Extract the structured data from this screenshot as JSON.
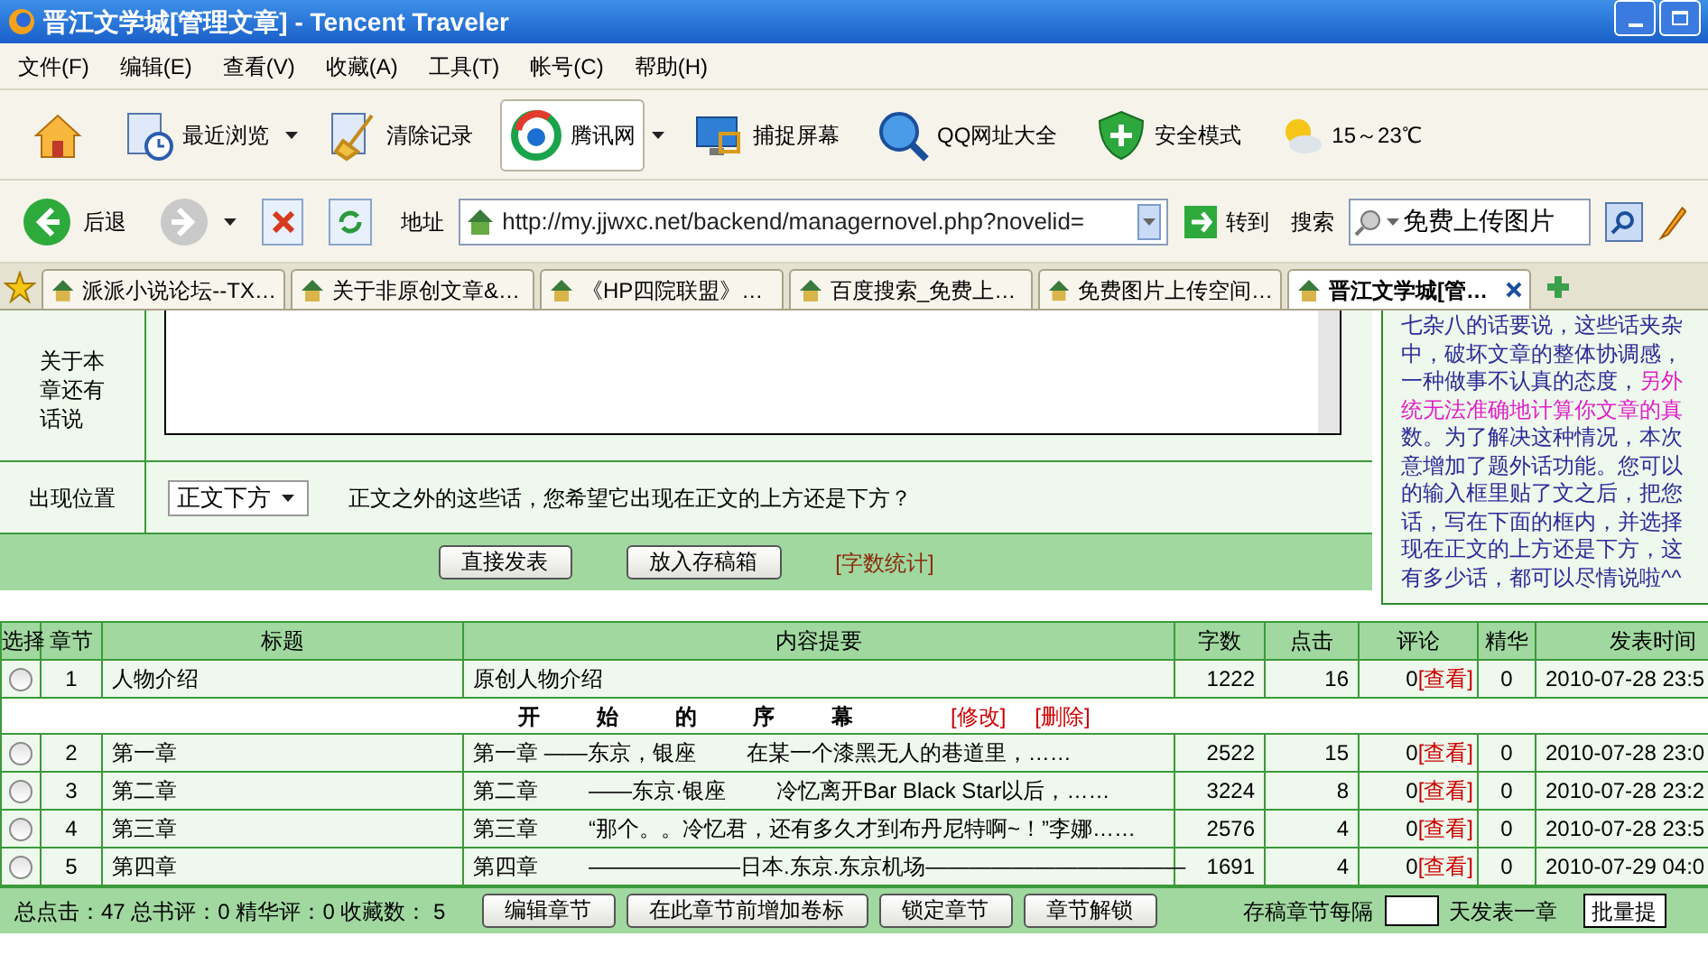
{
  "window": {
    "title": "晋江文学城[管理文章] - Tencent Traveler"
  },
  "menu": [
    "文件(F)",
    "编辑(E)",
    "查看(V)",
    "收藏(A)",
    "工具(T)",
    "帐号(C)",
    "帮助(H)"
  ],
  "toolbar": [
    {
      "kind": "home",
      "dropdown": false,
      "selected": false
    },
    {
      "kind": "history",
      "label": "最近浏览",
      "dropdown": true,
      "selected": false
    },
    {
      "kind": "clear",
      "label": "清除记录",
      "dropdown": false,
      "selected": false
    },
    {
      "kind": "portal",
      "label": "腾讯网",
      "dropdown": true,
      "selected": true
    },
    {
      "kind": "capture",
      "label": "捕捉屏幕",
      "dropdown": false,
      "selected": false
    },
    {
      "kind": "search",
      "label": "QQ网址大全",
      "dropdown": false,
      "selected": false
    },
    {
      "kind": "shield",
      "label": "安全模式",
      "dropdown": false,
      "selected": false
    },
    {
      "kind": "weather",
      "label": "15～23℃",
      "dropdown": false,
      "selected": false
    }
  ],
  "nav": {
    "back": "后退",
    "forward_disabled": true,
    "address_label": "地址",
    "url": "http://my.jjwxc.net/backend/managernovel.php?novelid=",
    "go": "转到",
    "search_label": "搜索",
    "search_value": "免费上传图片"
  },
  "tabs": [
    {
      "label": "派派小说论坛--TX…",
      "selected": false
    },
    {
      "label": "关于非原创文章&…",
      "selected": false
    },
    {
      "label": "《HP四院联盟》…",
      "selected": false
    },
    {
      "label": "百度搜索_免费上…",
      "selected": false
    },
    {
      "label": "免费图片上传空间…",
      "selected": false
    },
    {
      "label": "晋江文学城[管…",
      "selected": true
    }
  ],
  "form": {
    "note_label": "关于本章还有话说",
    "position_label": "出现位置",
    "position_value": "正文下方",
    "position_hint": "正文之外的这些话，您希望它出现在正文的上方还是下方？",
    "buttons": [
      "直接发表",
      "放入存稿箱"
    ],
    "word_count_link": "[字数统计]"
  },
  "notice": [
    [
      {
        "text": "七杂八的话要说，这些话夹杂",
        "highlight": false
      }
    ],
    [
      {
        "text": "中，破坏文章的整体协调感，",
        "highlight": false
      }
    ],
    [
      {
        "text": "一种做事不认真的态度，",
        "highlight": false
      },
      {
        "text": "另外",
        "highlight": true
      }
    ],
    [
      {
        "text": "统无法准确地计算你文章的真",
        "highlight": true
      }
    ],
    [
      {
        "text": "数。为了解决这种情况，本次",
        "highlight": false
      }
    ],
    [
      {
        "text": "意增加了题外话功能。您可以",
        "highlight": false
      }
    ],
    [
      {
        "text": "的输入框里贴了文之后，把您",
        "highlight": false
      }
    ],
    [
      {
        "text": "话，写在下面的框内，并选择",
        "highlight": false
      }
    ],
    [
      {
        "text": "现在正文的上方还是下方，这",
        "highlight": false
      }
    ],
    [
      {
        "text": "有多少话，都可以尽情说啦^^",
        "highlight": false
      }
    ]
  ],
  "table": {
    "columns": [
      "选择",
      "章节",
      "标题",
      "内容提要",
      "字数",
      "点击",
      "评论",
      "精华",
      "发表时间"
    ],
    "rows": [
      {
        "kind": "chapter",
        "selected": false,
        "number": "1",
        "title": "人物介绍",
        "summary": [
          "原创人物介绍"
        ],
        "words": "1222",
        "clicks": "16",
        "comments": "0",
        "comment_link": "[查看]",
        "featured": "0",
        "time": "2010-07-28 23:5"
      },
      {
        "kind": "volume",
        "volume_title": "开 始 的 序 幕",
        "edit": "[修改]",
        "delete": "[删除]"
      },
      {
        "kind": "chapter",
        "selected": false,
        "number": "2",
        "title": "第一章",
        "summary": [
          "第一章 ——东京，银座",
          "在某一个漆黑无人的巷道里，……"
        ],
        "words": "2522",
        "clicks": "15",
        "comments": "0",
        "comment_link": "[查看]",
        "featured": "0",
        "time": "2010-07-28 23:0"
      },
      {
        "kind": "chapter",
        "selected": false,
        "number": "3",
        "title": "第二章",
        "summary": [
          "第二章",
          "——东京·银座",
          "冷忆离开Bar Black Star以后，……"
        ],
        "words": "3224",
        "clicks": "8",
        "comments": "0",
        "comment_link": "[查看]",
        "featured": "0",
        "time": "2010-07-28 23:2"
      },
      {
        "kind": "chapter",
        "selected": false,
        "number": "4",
        "title": "第三章",
        "summary": [
          "第三章",
          "“那个。。冷忆君，还有多久才到布丹尼特啊~！”李娜……"
        ],
        "words": "2576",
        "clicks": "4",
        "comments": "0",
        "comment_link": "[查看]",
        "featured": "0",
        "time": "2010-07-28 23:5"
      },
      {
        "kind": "chapter",
        "selected": false,
        "number": "5",
        "title": "第四章",
        "summary": [
          "第四章",
          "———————日本.东京.东京机场————————————"
        ],
        "words": "1691",
        "clicks": "4",
        "comments": "0",
        "comment_link": "[查看]",
        "featured": "0",
        "time": "2010-07-29 04:0"
      }
    ]
  },
  "footer": {
    "stats": "总点击：47 总书评：0 精华评：0 收藏数： 5",
    "buttons": [
      "编辑章节",
      "在此章节前增加卷标",
      "锁定章节",
      "章节解锁"
    ],
    "schedule_before": "存稿章节每隔",
    "schedule_after": "天发表一章",
    "submit": "批量提"
  }
}
